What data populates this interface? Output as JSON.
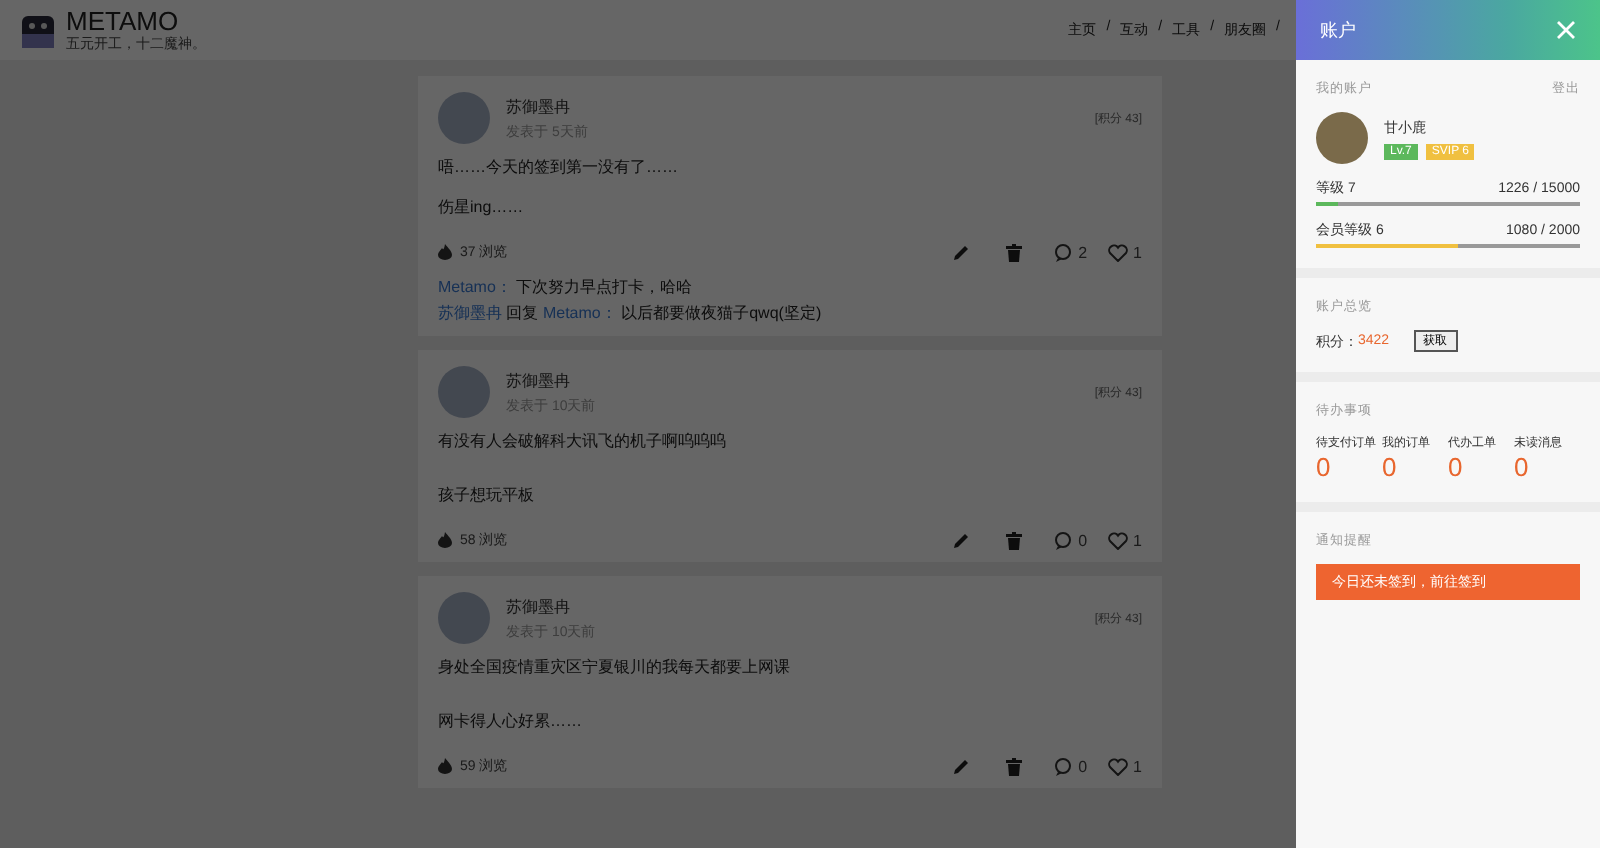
{
  "header": {
    "logo_title": "METAMO",
    "slogan": "五元开工，十二魔神。",
    "nav": [
      {
        "label": "主页",
        "separator": "/"
      },
      {
        "label": "互动",
        "separator": "/"
      },
      {
        "label": "工具",
        "separator": "/"
      },
      {
        "label": "朋友圈",
        "separator": "/"
      }
    ]
  },
  "posts": [
    {
      "author": "苏御墨冉",
      "time": "发表于 5天前",
      "points": "[积分 43]",
      "paragraphs": [
        "唔……今天的签到第一没有了……",
        "伤星ing……"
      ],
      "views": "37 浏览",
      "comments": "2",
      "likes": "1",
      "replies": [
        {
          "from": "Metamo：",
          "text": "下次努力早点打卡，哈哈"
        },
        {
          "from": "苏御墨冉",
          "action": "回复",
          "to": "Metamo：",
          "text": "以后都要做夜猫子qwq(坚定)"
        }
      ]
    },
    {
      "author": "苏御墨冉",
      "time": "发表于 10天前",
      "points": "[积分 43]",
      "paragraphs": [
        "有没有人会破解科大讯飞的机子啊呜呜呜",
        "孩子想玩平板"
      ],
      "views": "58 浏览",
      "comments": "0",
      "likes": "1"
    },
    {
      "author": "苏御墨冉",
      "time": "发表于 10天前",
      "points": "[积分 43]",
      "paragraphs": [
        "身处全国疫情重灾区宁夏银川的我每天都要上网课",
        "网卡得人心好累……"
      ],
      "views": "59 浏览",
      "comments": "0",
      "likes": "1"
    }
  ],
  "drawer": {
    "title": "账户",
    "account": {
      "heading": "我的账户",
      "logout": "登出",
      "username": "甘小鹿",
      "badges": [
        {
          "label": "Lv.7",
          "color": "#5cb85c"
        },
        {
          "label": "SVIP 6",
          "color": "#f0c040"
        }
      ],
      "progress": [
        {
          "label": "等级 7",
          "reading": "1226 / 15000",
          "level": 0.08,
          "color": "#5cb85c"
        },
        {
          "label": "会员等级 6",
          "reading": "1080 / 2000",
          "level": 0.54,
          "color": "#f0c040"
        }
      ]
    },
    "overview": {
      "heading": "账户总览",
      "points_label": "积分：",
      "points": "3422",
      "button": "获取"
    },
    "todo": {
      "heading": "待办事项",
      "items": [
        {
          "label": "待支付订单",
          "count": "0"
        },
        {
          "label": "我的订单",
          "count": "0"
        },
        {
          "label": "代办工单",
          "count": "0"
        },
        {
          "label": "未读消息",
          "count": "0"
        }
      ]
    },
    "notice": {
      "heading": "通知提醒",
      "alert": "今日还未签到，前往签到"
    }
  }
}
